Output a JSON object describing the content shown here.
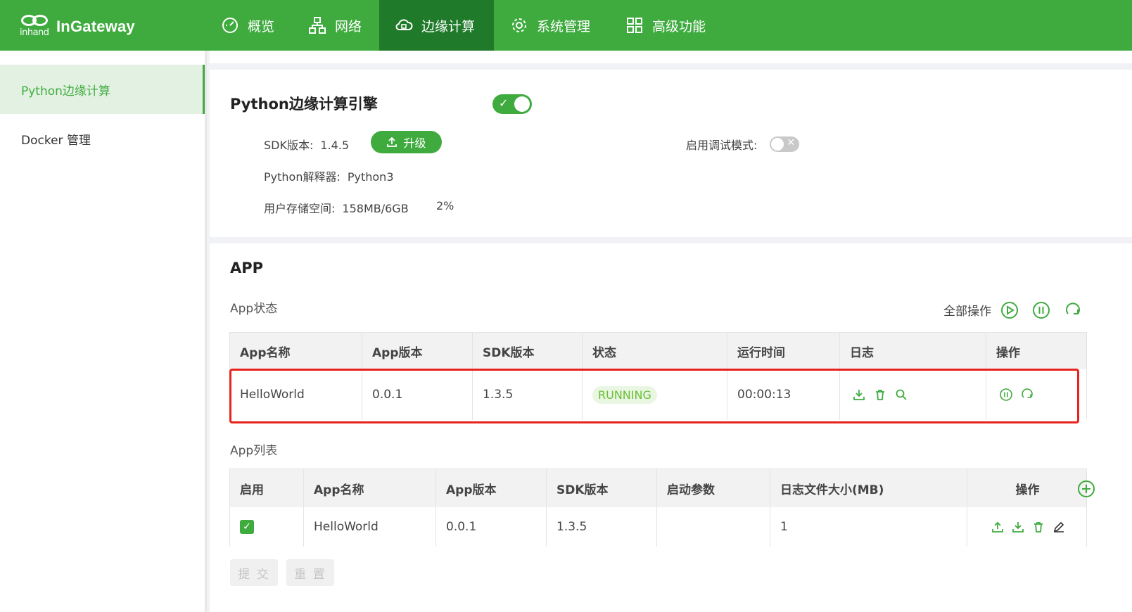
{
  "app": {
    "logo_sub": "inhand",
    "logo_name": "InGateway"
  },
  "nav": {
    "items": [
      {
        "label": "概览",
        "icon": "dashboard-icon"
      },
      {
        "label": "网络",
        "icon": "network-icon"
      },
      {
        "label": "边缘计算",
        "icon": "cloud-edge-icon",
        "active": true
      },
      {
        "label": "系统管理",
        "icon": "gear-icon"
      },
      {
        "label": "高级功能",
        "icon": "grid-icon"
      }
    ]
  },
  "sidebar": {
    "items": [
      {
        "label": "Python边缘计算",
        "active": true
      },
      {
        "label": "Docker 管理"
      }
    ]
  },
  "engine": {
    "title": "Python边缘计算引擎",
    "enabled": true,
    "sdk_label": "SDK版本:",
    "sdk_value": "1.4.5",
    "upgrade_label": "升级",
    "interpreter_label": "Python解释器:",
    "interpreter_value": "Python3",
    "storage_label": "用户存储空间:",
    "storage_value": "158MB/6GB",
    "storage_percent": "2%",
    "debug_label": "启用调试模式:",
    "debug_enabled": false
  },
  "app_section": {
    "title": "APP",
    "status_label": "App状态",
    "all_ops_label": "全部操作",
    "status_table": {
      "headers": [
        "App名称",
        "App版本",
        "SDK版本",
        "状态",
        "运行时间",
        "日志",
        "操作"
      ],
      "rows": [
        {
          "name": "HelloWorld",
          "version": "0.0.1",
          "sdk": "1.3.5",
          "state": "RUNNING",
          "uptime": "00:00:13"
        }
      ]
    },
    "list_label": "App列表",
    "list_table": {
      "headers": [
        "启用",
        "App名称",
        "App版本",
        "SDK版本",
        "启动参数",
        "日志文件大小(MB)",
        "操作"
      ],
      "rows": [
        {
          "enabled": true,
          "name": "HelloWorld",
          "version": "0.0.1",
          "sdk": "1.3.5",
          "params": "",
          "log_size": "1"
        }
      ]
    },
    "submit_label": "提 交",
    "reset_label": "重 置"
  },
  "colors": {
    "brand": "#3fab3f",
    "brand_dark": "#1f7a2a",
    "highlight": "#e8231d",
    "running": "#6cbf36"
  }
}
